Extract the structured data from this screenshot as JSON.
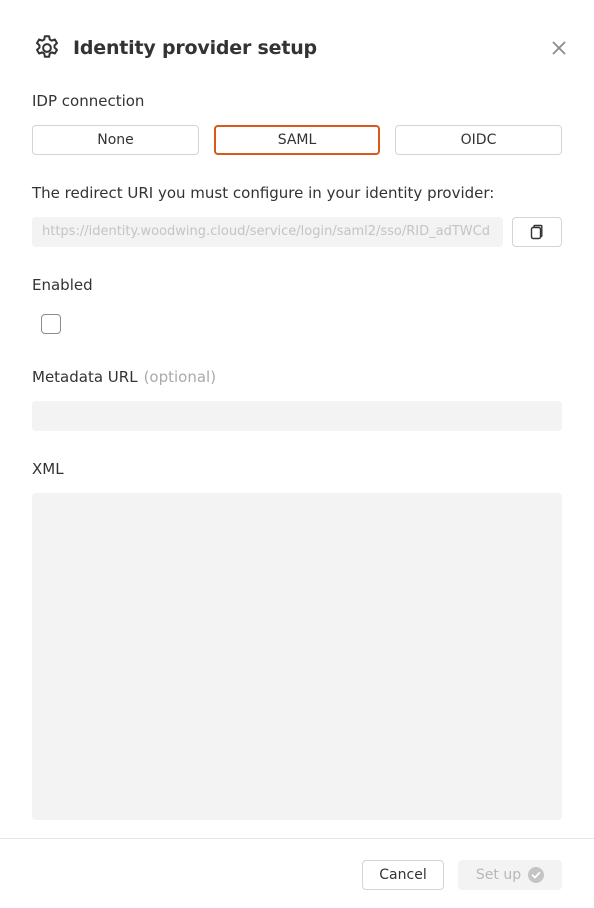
{
  "dialog": {
    "title": "Identity provider setup",
    "icon": "gear-icon",
    "close_icon": "close-icon"
  },
  "idp": {
    "label": "IDP connection",
    "options": [
      "None",
      "SAML",
      "OIDC"
    ],
    "selected": "SAML"
  },
  "redirect": {
    "label": "The redirect URI you must configure in your identity provider:",
    "value": "https://identity.woodwing.cloud/service/login/saml2/sso/RID_adTWCd",
    "copy_icon": "copy-icon"
  },
  "enabled": {
    "label": "Enabled",
    "checked": false
  },
  "metadata": {
    "label": "Metadata URL",
    "optional_label": "(optional)",
    "value": ""
  },
  "xml": {
    "label": "XML",
    "value": ""
  },
  "footer": {
    "cancel_label": "Cancel",
    "setup_label": "Set up",
    "setup_icon": "check-circle-icon"
  },
  "colors": {
    "accent": "#d9591c",
    "input_bg": "#f3f3f3",
    "disabled_text": "#b8b8b8"
  }
}
